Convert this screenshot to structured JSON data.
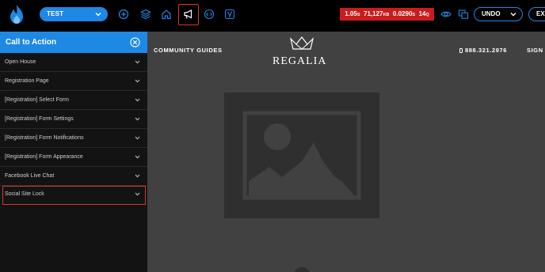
{
  "toolbar": {
    "site_name": "TEST",
    "icons": [
      "add-icon",
      "layers-icon",
      "home-icon",
      "megaphone-icon",
      "code-icon",
      "yoast-icon"
    ],
    "performance": {
      "time1": "1.05",
      "time1_unit": "S",
      "size": "71,127",
      "size_unit": "KB",
      "time2": "0.0290",
      "time2_unit": "S",
      "queries": "14",
      "queries_unit": "Q"
    },
    "undo_label": "UNDO",
    "exit_label": "EX",
    "accent_color": "#1e88e5",
    "alert_color": "#c91d1d"
  },
  "sidebar": {
    "title": "Call to Action",
    "items": [
      {
        "label": "Open House"
      },
      {
        "label": "Registration Page"
      },
      {
        "label": "[Registration] Select Form"
      },
      {
        "label": "[Registration] Form Settings"
      },
      {
        "label": "[Registration] Form Notifications"
      },
      {
        "label": "[Registration] Form Appearance"
      },
      {
        "label": "Facebook Live Chat"
      },
      {
        "label": "Social Site Lock"
      }
    ]
  },
  "preview": {
    "nav_left": "COMMUNITY GUIDES",
    "brand": "REGALIA",
    "phone": "888.321.2976",
    "nav_right": "SIGN"
  }
}
